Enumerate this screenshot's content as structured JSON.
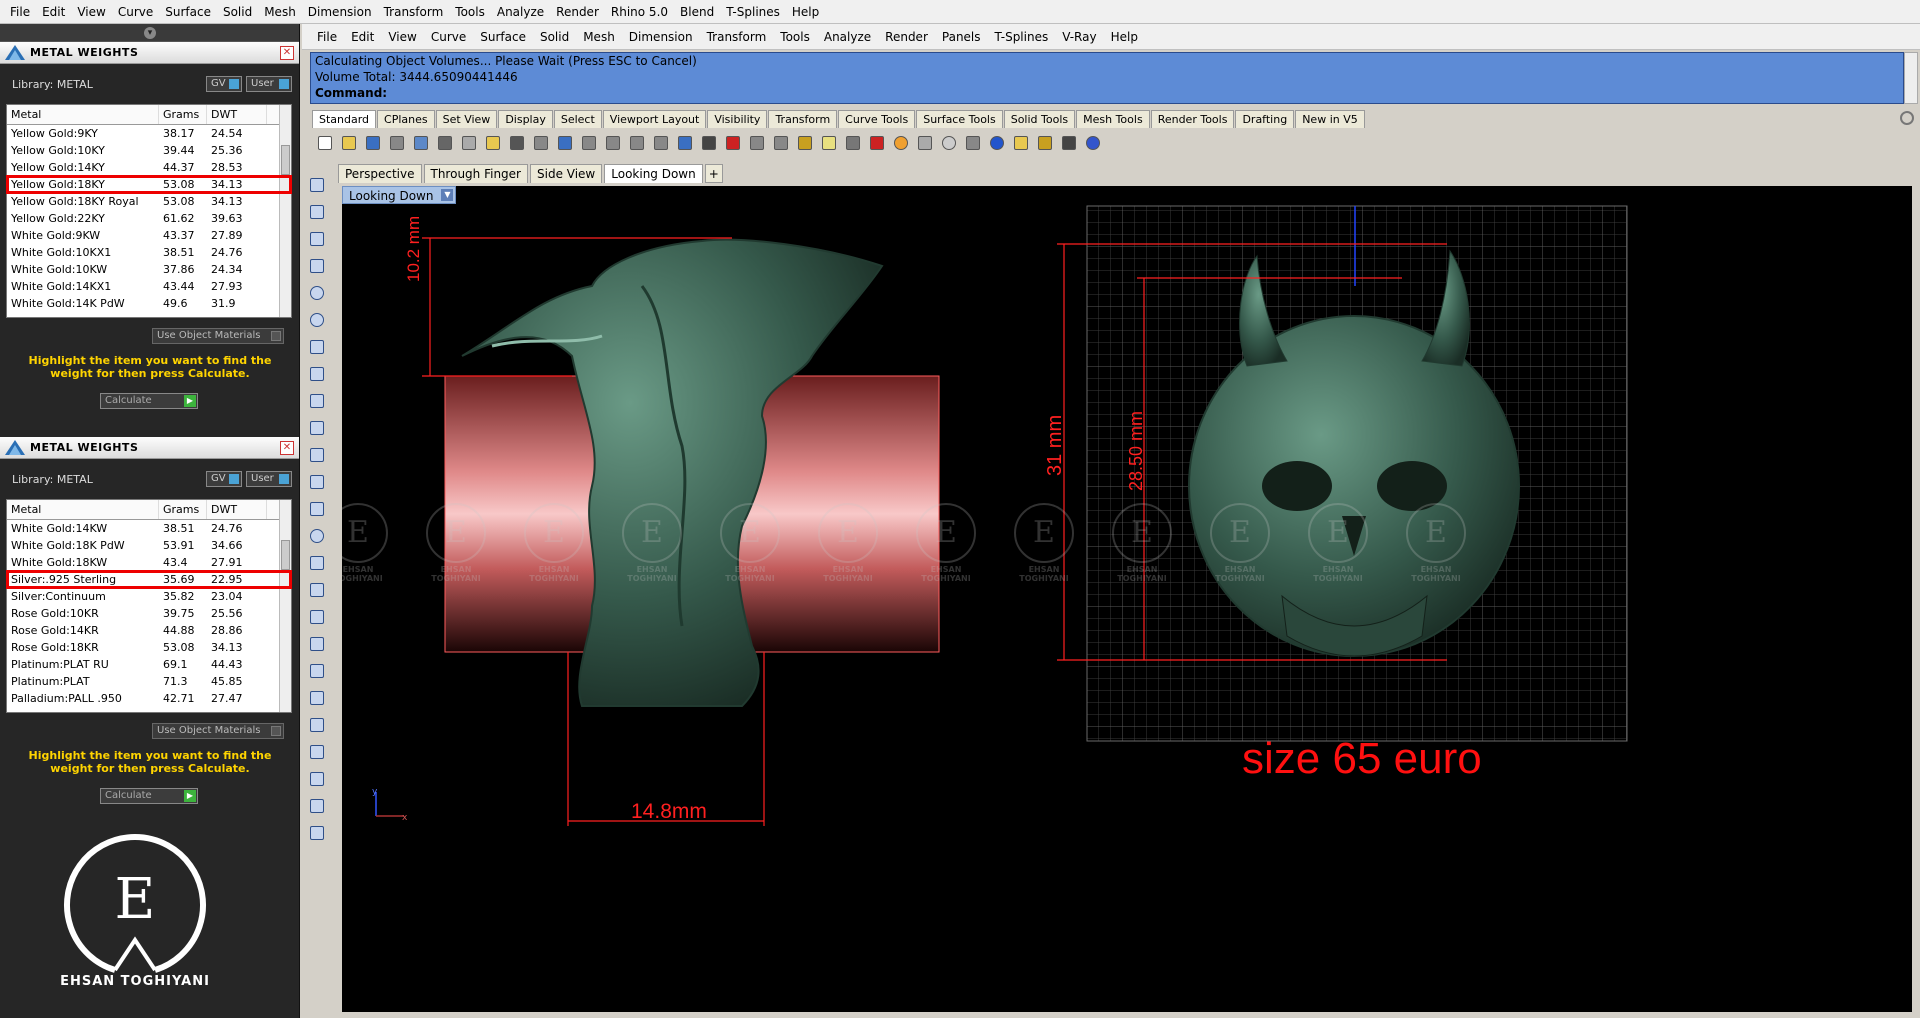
{
  "outer_menu": [
    "File",
    "Edit",
    "View",
    "Curve",
    "Surface",
    "Solid",
    "Mesh",
    "Dimension",
    "Transform",
    "Tools",
    "Analyze",
    "Render",
    "Rhino 5.0",
    "Blend",
    "T-Splines",
    "Help"
  ],
  "metal_panels": [
    {
      "title": "METAL WEIGHTS",
      "library": "Library: METAL",
      "btn_gv": "GV",
      "btn_user": "User",
      "headers": [
        "Metal",
        "Grams",
        "DWT"
      ],
      "rows": [
        [
          "Yellow Gold:9KY",
          "38.17",
          "24.54"
        ],
        [
          "Yellow Gold:10KY",
          "39.44",
          "25.36"
        ],
        [
          "Yellow Gold:14KY",
          "44.37",
          "28.53"
        ],
        [
          "Yellow Gold:18KY",
          "53.08",
          "34.13"
        ],
        [
          "Yellow Gold:18KY Royal",
          "53.08",
          "34.13"
        ],
        [
          "Yellow Gold:22KY",
          "61.62",
          "39.63"
        ],
        [
          "White Gold:9KW",
          "43.37",
          "27.89"
        ],
        [
          "White Gold:10KX1",
          "38.51",
          "24.76"
        ],
        [
          "White Gold:10KW",
          "37.86",
          "24.34"
        ],
        [
          "White Gold:14KX1",
          "43.44",
          "27.93"
        ],
        [
          "White Gold:14K PdW",
          "49.6",
          "31.9"
        ]
      ],
      "highlight_index": 3,
      "use_object": "Use Object Materials",
      "hint": "Highlight the item you want to find the weight for then press Calculate.",
      "calculate": "Calculate"
    },
    {
      "title": "METAL WEIGHTS",
      "library": "Library: METAL",
      "btn_gv": "GV",
      "btn_user": "User",
      "headers": [
        "Metal",
        "Grams",
        "DWT"
      ],
      "rows": [
        [
          "White Gold:14KW",
          "38.51",
          "24.76"
        ],
        [
          "White Gold:18K PdW",
          "53.91",
          "34.66"
        ],
        [
          "White Gold:18KW",
          "43.4",
          "27.91"
        ],
        [
          "Silver:.925 Sterling",
          "35.69",
          "22.95"
        ],
        [
          "Silver:Continuum",
          "35.82",
          "23.04"
        ],
        [
          "Rose Gold:10KR",
          "39.75",
          "25.56"
        ],
        [
          "Rose Gold:14KR",
          "44.88",
          "28.86"
        ],
        [
          "Rose Gold:18KR",
          "53.08",
          "34.13"
        ],
        [
          "Platinum:PLAT RU",
          "69.1",
          "44.43"
        ],
        [
          "Platinum:PLAT",
          "71.3",
          "45.85"
        ],
        [
          "Palladium:PALL .950",
          "42.71",
          "27.47"
        ]
      ],
      "highlight_index": 3,
      "use_object": "Use Object Materials",
      "hint": "Highlight the item you want to find the weight for then press Calculate.",
      "calculate": "Calculate"
    }
  ],
  "brand": {
    "letter": "E",
    "name": "EHSAN TOGHIYANI"
  },
  "rhino": {
    "menu": [
      "File",
      "Edit",
      "View",
      "Curve",
      "Surface",
      "Solid",
      "Mesh",
      "Dimension",
      "Transform",
      "Tools",
      "Analyze",
      "Render",
      "Panels",
      "T-Splines",
      "V-Ray",
      "Help"
    ],
    "command_lines": [
      "Calculating Object Volumes... Please Wait (Press ESC to Cancel)",
      "Volume Total: 3444.65090441446",
      "Command:"
    ],
    "toolbar_tabs": [
      "Standard",
      "CPlanes",
      "Set View",
      "Display",
      "Select",
      "Viewport Layout",
      "Visibility",
      "Transform",
      "Curve Tools",
      "Surface Tools",
      "Solid Tools",
      "Mesh Tools",
      "Render Tools",
      "Drafting",
      "New in V5"
    ],
    "viewport_tabs": [
      "Perspective",
      "Through Finger",
      "Side View",
      "Looking Down"
    ],
    "active_viewport_tab": 3,
    "viewport_label": "Looking Down",
    "dimensions": {
      "side_height": "10.2 mm",
      "side_width": "14.8mm",
      "front_height": "31 mm",
      "front_inner_height": "28.50 mm"
    },
    "size_note": "size 65 euro",
    "watermark_name": "EHSAN TOGHIYANI",
    "axis_x": "x",
    "axis_y": "y"
  }
}
